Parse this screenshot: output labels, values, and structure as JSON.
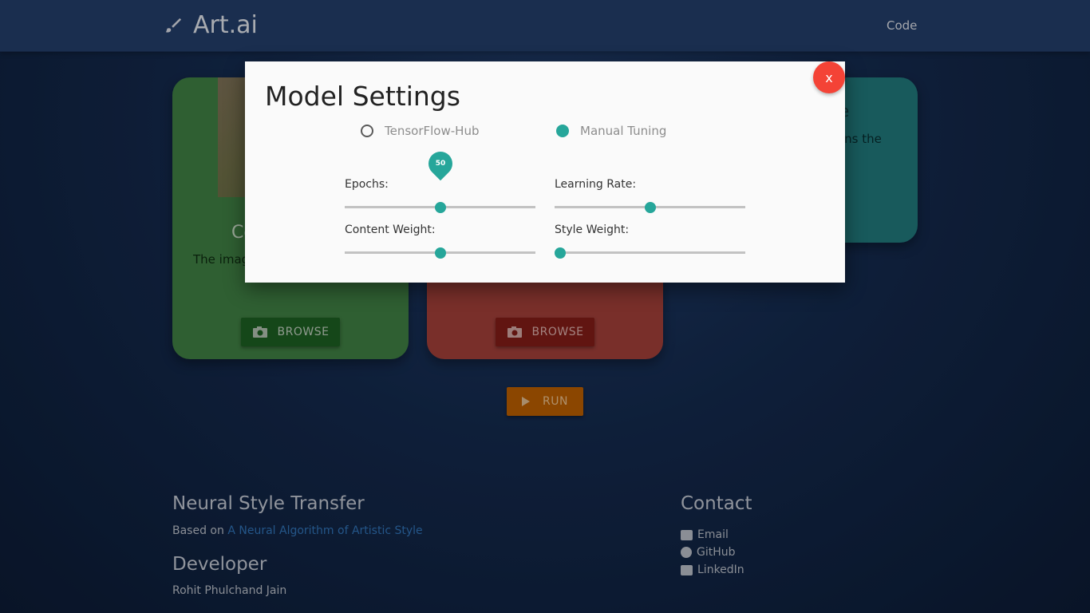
{
  "navbar": {
    "brand": "Art.ai",
    "code_link": "Code"
  },
  "cards": {
    "content": {
      "title_partial": "Co",
      "desc_partial": "The imag",
      "browse_label": "BROWSE"
    },
    "style": {
      "browse_label": "BROWSE"
    },
    "result": {
      "title_partial": "e",
      "desc_partial": "ins the"
    }
  },
  "run_label": "RUN",
  "modal": {
    "title": "Model Settings",
    "close_label": "x",
    "radio_options": [
      {
        "label": "TensorFlow-Hub",
        "selected": false
      },
      {
        "label": "Manual Tuning",
        "selected": true
      }
    ],
    "sliders": {
      "epochs": {
        "label": "Epochs:",
        "value": 50,
        "fraction": 0.5,
        "bubble": "50"
      },
      "learning_rate": {
        "label": "Learning Rate:",
        "fraction": 0.5
      },
      "content_weight": {
        "label": "Content Weight:",
        "fraction": 0.5
      },
      "style_weight": {
        "label": "Style Weight:",
        "fraction": 0.03
      }
    },
    "accent_color": "#26a69a"
  },
  "footer": {
    "nst_title": "Neural Style Transfer",
    "based_on_prefix": "Based on ",
    "based_on_link": "A Neural Algorithm of Artistic Style",
    "developer_title": "Developer",
    "developer_name": "Rohit Phulchand Jain",
    "contact_title": "Contact",
    "contact_items": [
      "Email",
      "GitHub",
      "LinkedIn"
    ]
  }
}
